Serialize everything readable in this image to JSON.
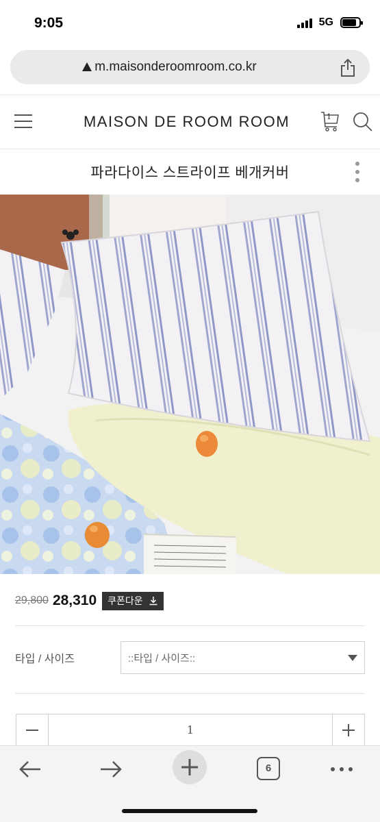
{
  "status": {
    "time": "9:05",
    "network": "5G"
  },
  "browser": {
    "url": "m.maisonderoomroom.co.kr",
    "tab_count": "6"
  },
  "header": {
    "logo": "MAISON DE ROOM ROOM",
    "cart_count": "1"
  },
  "product": {
    "title": "파라다이스 스트라이프 베개커버",
    "original_price": "29,800",
    "sale_price": "28,310",
    "coupon_label": "쿠폰다운"
  },
  "options": {
    "label": "타입 / 사이즈",
    "select_value": "::타입 / 사이즈::"
  },
  "quantity": {
    "value": "1"
  },
  "colors": {
    "coupon_bg": "#333333",
    "toolbar_bg": "#f4f4f4",
    "url_bar_bg": "#eaeaea"
  }
}
